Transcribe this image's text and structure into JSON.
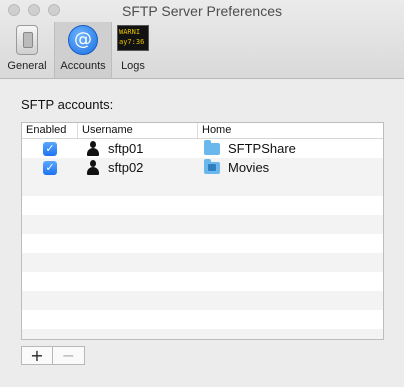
{
  "window": {
    "title": "SFTP Server Preferences"
  },
  "toolbar": {
    "items": [
      {
        "label": "General",
        "icon": "switch-icon",
        "selected": false
      },
      {
        "label": "Accounts",
        "icon": "at-sign-icon",
        "selected": true
      },
      {
        "label": "Logs",
        "icon": "terminal-log-icon",
        "selected": false,
        "icon_text": [
          "WARNI",
          "ay7:36"
        ]
      }
    ]
  },
  "accounts": {
    "section_label": "SFTP accounts:",
    "columns": [
      "Enabled",
      "Username",
      "Home"
    ],
    "rows": [
      {
        "enabled": true,
        "username": "sftp01",
        "home": "SFTPShare",
        "home_icon": "folder-icon"
      },
      {
        "enabled": true,
        "username": "sftp02",
        "home": "Movies",
        "home_icon": "movies-folder-icon"
      }
    ],
    "checkmark": "✓",
    "add_label": "+",
    "remove_label": "−"
  },
  "colors": {
    "accent": "#1e72f2",
    "folder": "#6ab7ee"
  }
}
